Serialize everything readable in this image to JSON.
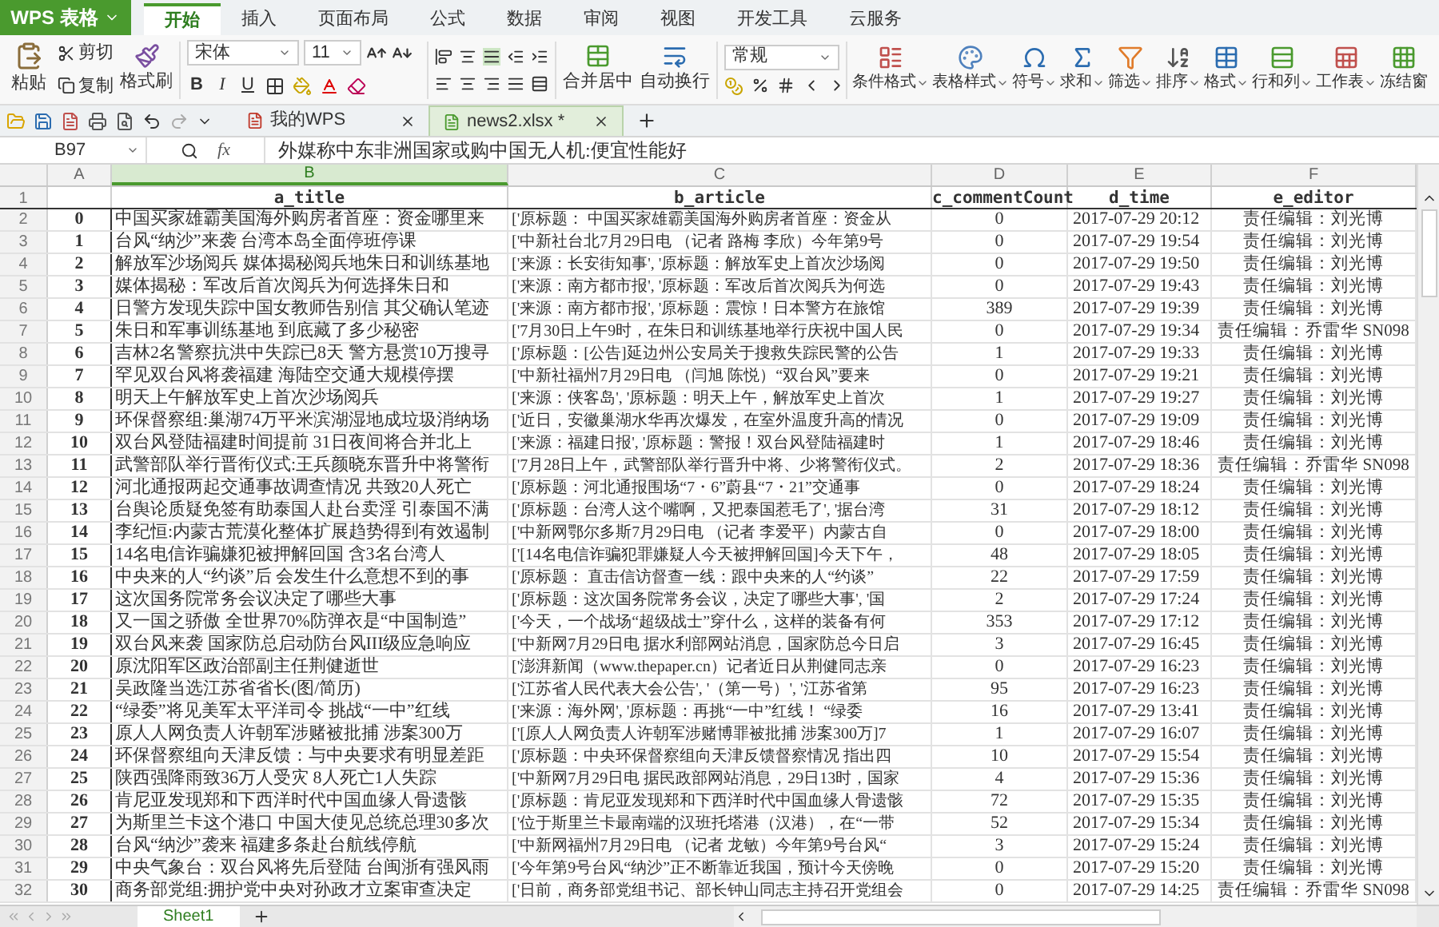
{
  "app": {
    "title": "WPS 表格"
  },
  "ribbon_tabs": [
    {
      "label": "开始",
      "selected": true
    },
    {
      "label": "插入",
      "selected": false
    },
    {
      "label": "页面布局",
      "selected": false
    },
    {
      "label": "公式",
      "selected": false
    },
    {
      "label": "数据",
      "selected": false
    },
    {
      "label": "审阅",
      "selected": false
    },
    {
      "label": "视图",
      "selected": false
    },
    {
      "label": "开发工具",
      "selected": false
    },
    {
      "label": "云服务",
      "selected": false
    }
  ],
  "clipboard": {
    "paste": "粘贴",
    "cut": "剪切",
    "copy": "复制",
    "format_painter": "格式刷"
  },
  "font": {
    "name": "宋体",
    "size": "11",
    "bold": "B",
    "italic": "I",
    "underline": "U"
  },
  "alignment": {
    "merge": "合并居中",
    "wrap": "自动换行"
  },
  "number": {
    "format": "常规"
  },
  "tools": [
    {
      "label": "条件格式",
      "dropdown": true
    },
    {
      "label": "表格样式",
      "dropdown": true
    },
    {
      "label": "符号",
      "dropdown": true
    },
    {
      "label": "求和",
      "dropdown": true
    },
    {
      "label": "筛选",
      "dropdown": true
    },
    {
      "label": "排序",
      "dropdown": true
    },
    {
      "label": "格式",
      "dropdown": true
    },
    {
      "label": "行和列",
      "dropdown": true
    },
    {
      "label": "工作表",
      "dropdown": true
    },
    {
      "label": "冻结窗",
      "dropdown": false
    }
  ],
  "doc_tabs": [
    {
      "label": "我的WPS",
      "selected": false
    },
    {
      "label": "news2.xlsx *",
      "selected": true
    }
  ],
  "formula_bar": {
    "cell": "B97",
    "fx": "fx",
    "value": "外媒称中东非洲国家或购中国无人机:便宜性能好"
  },
  "columns": [
    {
      "label": "A",
      "selected": false
    },
    {
      "label": "B",
      "selected": true
    },
    {
      "label": "C",
      "selected": false
    },
    {
      "label": "D",
      "selected": false
    },
    {
      "label": "E",
      "selected": false
    },
    {
      "label": "F",
      "selected": false
    }
  ],
  "header_row": {
    "n": "1",
    "headers": [
      "a_title",
      "b_article",
      "c_commentCount",
      "d_time",
      "e_editor"
    ]
  },
  "rows": [
    {
      "n": "2",
      "cells": [
        "0",
        "中国买家雄霸美国海外购房者首座：资金哪里来",
        "['原标题： 中国买家雄霸美国海外购房者首座：资金从",
        "0",
        "2017-07-29 20:12",
        "责任编辑：刘光博"
      ]
    },
    {
      "n": "3",
      "cells": [
        "1",
        "台风“纳沙”来袭 台湾本岛全面停班停课",
        "['中新社台北7月29日电 （记者 路梅 李欣）今年第9号",
        "0",
        "2017-07-29 19:54",
        "责任编辑：刘光博"
      ]
    },
    {
      "n": "4",
      "cells": [
        "2",
        "解放军沙场阅兵 媒体揭秘阅兵地朱日和训练基地",
        "['来源：长安街知事', '原标题：解放军史上首次沙场阅",
        "0",
        "2017-07-29 19:50",
        "责任编辑：刘光博"
      ]
    },
    {
      "n": "5",
      "cells": [
        "3",
        "媒体揭秘：军改后首次阅兵为何选择朱日和",
        "['来源：南方都市报', '原标题：军改后首次阅兵为何选",
        "0",
        "2017-07-29 19:43",
        "责任编辑：刘光博"
      ]
    },
    {
      "n": "6",
      "cells": [
        "4",
        "日警方发现失踪中国女教师告别信 其父确认笔迹",
        "['来源：南方都市报', '原标题：震惊！日本警方在旅馆",
        "389",
        "2017-07-29 19:39",
        "责任编辑：刘光博"
      ]
    },
    {
      "n": "7",
      "cells": [
        "5",
        "朱日和军事训练基地 到底藏了多少秘密",
        "['7月30日上午9时，在朱日和训练基地举行庆祝中国人民",
        "0",
        "2017-07-29 19:34",
        "责任编辑：乔雷华 SN098"
      ]
    },
    {
      "n": "8",
      "cells": [
        "6",
        "吉林2名警察抗洪中失踪已8天 警方悬赏10万搜寻",
        "['原标题：[公告]延边州公安局关于搜救失踪民警的公告",
        "1",
        "2017-07-29 19:33",
        "责任编辑：刘光博"
      ]
    },
    {
      "n": "9",
      "cells": [
        "7",
        "罕见双台风将袭福建 海陆空交通大规模停摆",
        "['中新社福州7月29日电 （闫旭 陈悦）“双台风”要来",
        "0",
        "2017-07-29 19:21",
        "责任编辑：刘光博"
      ]
    },
    {
      "n": "10",
      "cells": [
        "8",
        "明天上午解放军史上首次沙场阅兵",
        "['来源：侠客岛', '原标题：明天上午，解放军史上首次",
        "1",
        "2017-07-29 19:27",
        "责任编辑：刘光博"
      ]
    },
    {
      "n": "11",
      "cells": [
        "9",
        "环保督察组:巢湖74万平米滨湖湿地成垃圾消纳场",
        "['近日，安徽巢湖水华再次爆发，在室外温度升高的情况",
        "0",
        "2017-07-29 19:09",
        "责任编辑：刘光博"
      ]
    },
    {
      "n": "12",
      "cells": [
        "10",
        "双台风登陆福建时间提前 31日夜间将合并北上",
        "['来源：福建日报', '原标题：警报！双台风登陆福建时",
        "1",
        "2017-07-29 18:46",
        "责任编辑：刘光博"
      ]
    },
    {
      "n": "13",
      "cells": [
        "11",
        "武警部队举行晋衔仪式:王兵颜晓东晋升中将警衔",
        "['7月28日上午，武警部队举行晋升中将、少将警衔仪式。",
        "2",
        "2017-07-29 18:36",
        "责任编辑：乔雷华 SN098"
      ]
    },
    {
      "n": "14",
      "cells": [
        "12",
        "河北通报两起交通事故调查情况 共致20人死亡",
        "['原标题：河北通报围场“7・6”蔚县“7・21”交通事",
        "0",
        "2017-07-29 18:24",
        "责任编辑：刘光博"
      ]
    },
    {
      "n": "15",
      "cells": [
        "13",
        "台舆论质疑免签有助泰国人赴台卖淫 引泰国不满",
        "['原标题：台湾人这个嘴啊，又把泰国惹毛了', '据台湾",
        "31",
        "2017-07-29 18:12",
        "责任编辑：刘光博"
      ]
    },
    {
      "n": "16",
      "cells": [
        "14",
        "李纪恒:内蒙古荒漠化整体扩展趋势得到有效遏制",
        "['中新网鄂尔多斯7月29日电 （记者 李爱平）内蒙古自",
        "0",
        "2017-07-29 18:00",
        "责任编辑：刘光博"
      ]
    },
    {
      "n": "17",
      "cells": [
        "15",
        "14名电信诈骗嫌犯被押解回国 含3名台湾人",
        "['[14名电信诈骗犯罪嫌疑人今天被押解回国]今天下午，",
        "48",
        "2017-07-29 18:05",
        "责任编辑：刘光博"
      ]
    },
    {
      "n": "18",
      "cells": [
        "16",
        "中央来的人“约谈”后 会发生什么意想不到的事",
        "['原标题： 直击信访督查一线：跟中央来的人“约谈”",
        "22",
        "2017-07-29 17:59",
        "责任编辑：刘光博"
      ]
    },
    {
      "n": "19",
      "cells": [
        "17",
        "这次国务院常务会议决定了哪些大事",
        "['原标题：这次国务院常务会议，决定了哪些大事', '国",
        "2",
        "2017-07-29 17:24",
        "责任编辑：刘光博"
      ]
    },
    {
      "n": "20",
      "cells": [
        "18",
        "又一国之骄傲 全世界70%防弹衣是“中国制造”",
        "['今天，一个战场“超级战士”穿什么，这样的装备有何",
        "353",
        "2017-07-29 17:12",
        "责任编辑：刘光博"
      ]
    },
    {
      "n": "21",
      "cells": [
        "19",
        "双台风来袭 国家防总启动防台风III级应急响应",
        "['中新网7月29日电 据水利部网站消息，国家防总今日启",
        "3",
        "2017-07-29 16:45",
        "责任编辑：刘光博"
      ]
    },
    {
      "n": "22",
      "cells": [
        "20",
        "原沈阳军区政治部副主任荆健逝世",
        "['澎湃新闻（www.thepaper.cn）记者近日从荆健同志亲",
        "0",
        "2017-07-29 16:23",
        "责任编辑：刘光博"
      ]
    },
    {
      "n": "23",
      "cells": [
        "21",
        "吴政隆当选江苏省省长(图/简历)",
        "['江苏省人民代表大会公告', '（第一号）', '江苏省第",
        "95",
        "2017-07-29 16:23",
        "责任编辑：刘光博"
      ]
    },
    {
      "n": "24",
      "cells": [
        "22",
        "“绿委”将见美军太平洋司令 挑战“一中”红线",
        "['来源：海外网', '原标题：再挑“一中”红线！ “绿委",
        "16",
        "2017-07-29 13:41",
        "责任编辑：刘光博"
      ]
    },
    {
      "n": "25",
      "cells": [
        "23",
        "原人人网负责人许朝军涉赌被批捕 涉案300万",
        "['[原人人网负责人许朝军涉赌博罪被批捕 涉案300万]7",
        "1",
        "2017-07-29 16:07",
        "责任编辑：刘光博"
      ]
    },
    {
      "n": "26",
      "cells": [
        "24",
        "环保督察组向天津反馈：与中央要求有明显差距",
        "['原标题：中央环保督察组向天津反馈督察情况 指出四",
        "10",
        "2017-07-29 15:54",
        "责任编辑：刘光博"
      ]
    },
    {
      "n": "27",
      "cells": [
        "25",
        "陕西强降雨致36万人受灾 8人死亡1人失踪",
        "['中新网7月29日电 据民政部网站消息，29日13时，国家",
        "4",
        "2017-07-29 15:36",
        "责任编辑：刘光博"
      ]
    },
    {
      "n": "28",
      "cells": [
        "26",
        "肯尼亚发现郑和下西洋时代中国血缘人骨遗骸",
        "['原标题：肯尼亚发现郑和下西洋时代中国血缘人骨遗骸",
        "72",
        "2017-07-29 15:35",
        "责任编辑：刘光博"
      ]
    },
    {
      "n": "29",
      "cells": [
        "27",
        "为斯里兰卡这个港口 中国大使见总统总理30多次",
        "['位于斯里兰卡最南端的汉班托塔港（汉港），在“一带",
        "52",
        "2017-07-29 15:34",
        "责任编辑：刘光博"
      ]
    },
    {
      "n": "30",
      "cells": [
        "28",
        "台风“纳沙”袭来 福建多条赴台航线停航",
        "['中新网福州7月29日电 （记者 龙敏）今年第9号台风“",
        "3",
        "2017-07-29 15:24",
        "责任编辑：刘光博"
      ]
    },
    {
      "n": "31",
      "cells": [
        "29",
        "中央气象台：双台风将先后登陆 台闽浙有强风雨",
        "['今年第9号台风“纳沙”正不断靠近我国，预计今天傍晚",
        "0",
        "2017-07-29 15:20",
        "责任编辑：刘光博"
      ]
    },
    {
      "n": "32",
      "cells": [
        "30",
        "商务部党组:拥护党中央对孙政才立案审查决定",
        "['日前，商务部党组书记、部长钟山同志主持召开党组会",
        "0",
        "2017-07-29 14:25",
        "责任编辑：乔雷华 SN098"
      ]
    }
  ],
  "sheet_tabs": [
    {
      "label": "Sheet1",
      "selected": true
    }
  ]
}
